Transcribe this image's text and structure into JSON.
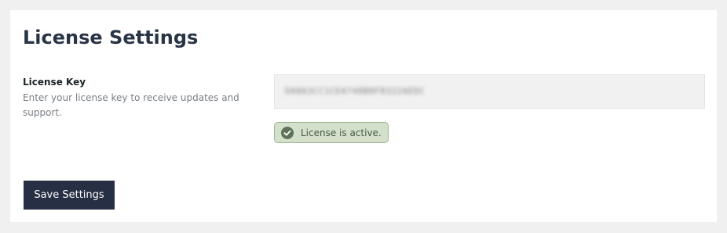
{
  "header": {
    "title": "License Settings"
  },
  "license_field": {
    "label": "License Key",
    "description": "Enter your license key to receive updates and support.",
    "value": "DA8A3CC1CEA748B0F8322AEDC",
    "status": {
      "text": "License is active.",
      "icon": "check-circle-icon",
      "color": "#d3e0cc"
    }
  },
  "actions": {
    "save_label": "Save Settings"
  },
  "colors": {
    "accent": "#272f45",
    "status_bg": "#d3e0cc",
    "status_border": "#9db593"
  }
}
